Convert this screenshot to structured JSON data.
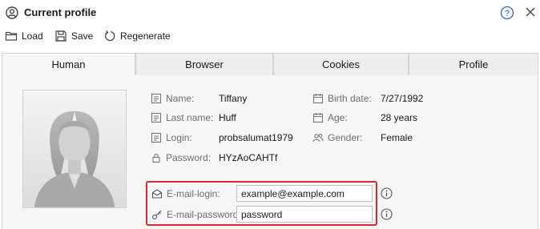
{
  "window": {
    "title": "Current profile"
  },
  "toolbar": {
    "load_label": "Load",
    "save_label": "Save",
    "regenerate_label": "Regenerate"
  },
  "tabs": [
    {
      "label": "Human",
      "active": true
    },
    {
      "label": "Browser",
      "active": false
    },
    {
      "label": "Cookies",
      "active": false
    },
    {
      "label": "Profile",
      "active": false
    }
  ],
  "profile": {
    "name": {
      "label": "Name:",
      "value": "Tiffany"
    },
    "last_name": {
      "label": "Last name:",
      "value": "Huff"
    },
    "login": {
      "label": "Login:",
      "value": "probsalumat1979"
    },
    "password": {
      "label": "Password:",
      "value": "HYzAoCAHTf"
    },
    "birth_date": {
      "label": "Birth date:",
      "value": "7/27/1992"
    },
    "age": {
      "label": "Age:",
      "value": "28 years"
    },
    "gender": {
      "label": "Gender:",
      "value": "Female"
    }
  },
  "email": {
    "login_label": "E-mail-login:",
    "login_value": "example@example.com",
    "password_label": "E-mail-password:",
    "password_value": "password",
    "highlight_color": "#e0262a"
  },
  "icons": {
    "title": "user-circle-icon",
    "help": "question-circle-icon",
    "close": "close-icon",
    "load": "folder-icon",
    "save": "floppy-disk-icon",
    "regenerate": "refresh-icon",
    "avatar": "female-silhouette-icon",
    "email": "envelope-icon",
    "key": "key-icon",
    "info": "info-circle-icon"
  }
}
